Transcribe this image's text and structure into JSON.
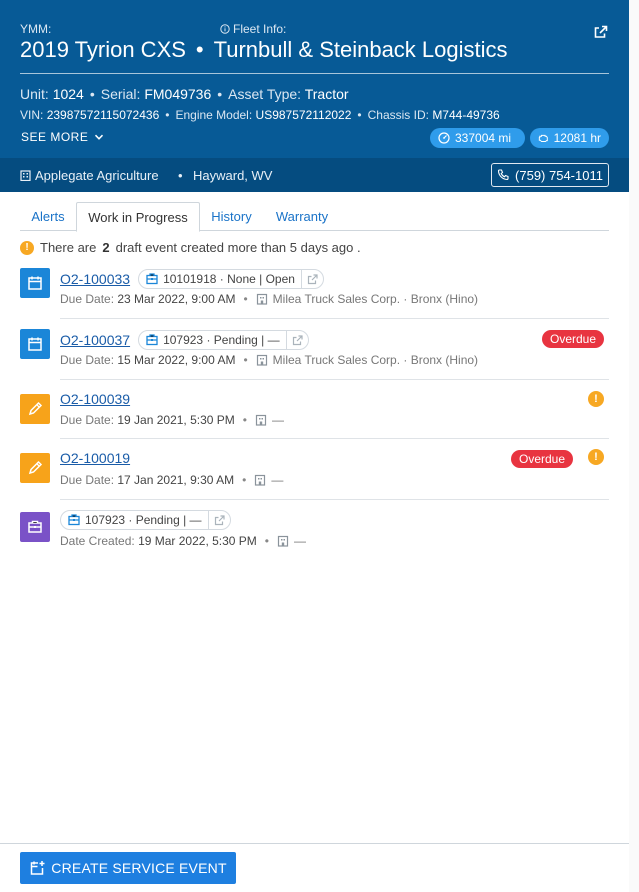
{
  "header": {
    "ymm_label": "YMM:",
    "fleet_label": "Fleet  Info:",
    "vehicle_title": "2019 Tyrion CXS",
    "title_separator": "•",
    "fleet_name": "Turnbull & Steinback Logistics",
    "unit_label": "Unit:",
    "unit_value": "1024",
    "serial_label": "Serial:",
    "serial_value": "FM049736",
    "asset_type_label": "Asset Type:",
    "asset_type_value": "Tractor",
    "vin_label": "VIN:",
    "vin_value": "23987572115072436",
    "engine_model_label": "Engine Model:",
    "engine_model_value": "US987572112022",
    "chassis_label": "Chassis ID:",
    "chassis_value": "M744-49736",
    "see_more": "SEE MORE",
    "miles": "337004 mi",
    "hours": "12081 hr",
    "bullet": "•"
  },
  "dealer": {
    "name": "Applegate Agriculture",
    "location": "Hayward, WV",
    "phone": "(759) 754-1011"
  },
  "tabs": [
    {
      "label": "Alerts"
    },
    {
      "label": "Work in Progress",
      "active": true
    },
    {
      "label": "History"
    },
    {
      "label": "Warranty"
    }
  ],
  "notice": {
    "pre": "There are",
    "count": "2",
    "post": "draft event created more than 5 days ago ."
  },
  "events": [
    {
      "id": "O2-100033",
      "work_order": "10101918 · None | Open",
      "date_label": "Due Date:",
      "date_value": "23 Mar 2022, 9:00 AM",
      "shop": "Milea Truck Sales Corp. · Bronx (Hino)"
    },
    {
      "id": "O2-100037",
      "work_order": "107923 · Pending | —",
      "date_label": "Due Date:",
      "date_value": "15 Mar 2022, 9:00 AM",
      "shop": "Milea Truck Sales Corp. · Bronx (Hino)",
      "badge": "Overdue"
    },
    {
      "id": "O2-100039",
      "date_label": "Due Date:",
      "date_value": "19 Jan 2021, 5:30 PM",
      "shop": "—",
      "warning": "!"
    },
    {
      "id": "O2-100019",
      "date_label": "Due Date:",
      "date_value": "17 Jan 2021, 9:30 AM",
      "shop": "—",
      "badge": "Overdue",
      "warning": "!"
    },
    {
      "work_order": "107923 · Pending | —",
      "date_label": "Date Created:",
      "date_value": "19 Mar 2022, 5:30 PM",
      "shop": "—"
    }
  ],
  "footer": {
    "create_button": "CREATE SERVICE EVENT"
  },
  "colors": {
    "header_bg": "#075a96",
    "dealer_bg": "#054c80",
    "pill_bg": "#2f9ceb",
    "link": "#1a5ca8",
    "overdue": "#e83440",
    "warning": "#f7a823",
    "primary_button": "#1e7fe0"
  }
}
